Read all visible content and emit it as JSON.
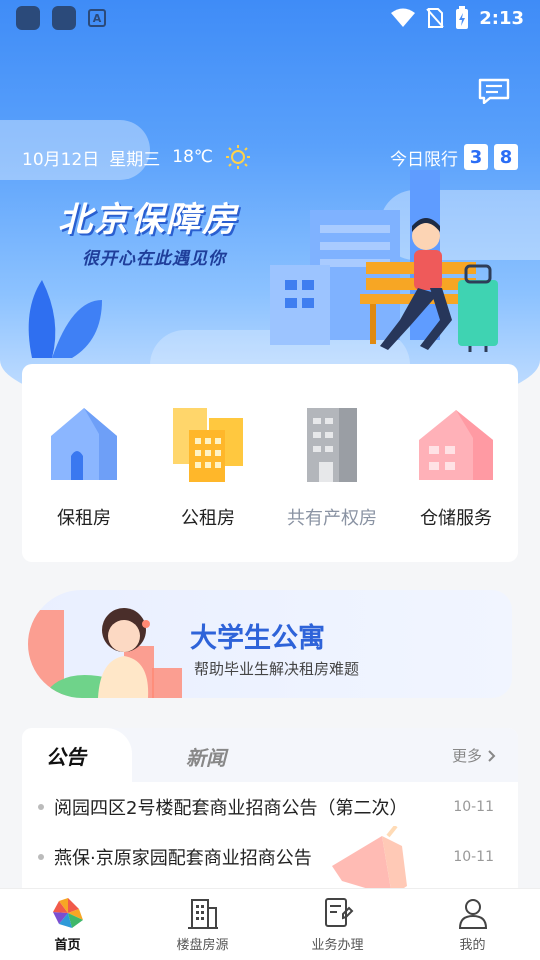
{
  "status_bar": {
    "time": "2:13"
  },
  "weather": {
    "date": "10月12日",
    "weekday": "星期三",
    "temperature": "18℃",
    "icon": "sun-icon"
  },
  "traffic_limit": {
    "label": "今日限行",
    "numbers": [
      "3",
      "8"
    ]
  },
  "hero": {
    "title": "北京保障房",
    "subtitle": "很开心在此遇见你"
  },
  "categories": [
    {
      "label": "保租房",
      "icon": "blue-house-icon",
      "enabled": true
    },
    {
      "label": "公租房",
      "icon": "yellow-buildings-icon",
      "enabled": true
    },
    {
      "label": "共有产权房",
      "icon": "gray-building-icon",
      "enabled": false
    },
    {
      "label": "仓储服务",
      "icon": "pink-house-icon",
      "enabled": true
    }
  ],
  "promo": {
    "title": "大学生公寓",
    "subtitle": "帮助毕业生解决租房难题"
  },
  "news": {
    "tabs": [
      "公告",
      "新闻"
    ],
    "more_label": "更多",
    "items": [
      {
        "title": "阅园四区2号楼配套商业招商公告（第二次）",
        "date": "10-11"
      },
      {
        "title": "燕保·京原家园配套商业招商公告",
        "date": "10-11"
      }
    ]
  },
  "tabbar": [
    {
      "label": "首页",
      "icon": "home-logo-icon",
      "active": true
    },
    {
      "label": "楼盘房源",
      "icon": "building-icon",
      "active": false
    },
    {
      "label": "业务办理",
      "icon": "document-pen-icon",
      "active": false
    },
    {
      "label": "我的",
      "icon": "user-icon",
      "active": false
    }
  ],
  "colors": {
    "primary": "#2e63d9",
    "hero_top": "#3f8cf7",
    "limit_num": "#2a6df5"
  }
}
